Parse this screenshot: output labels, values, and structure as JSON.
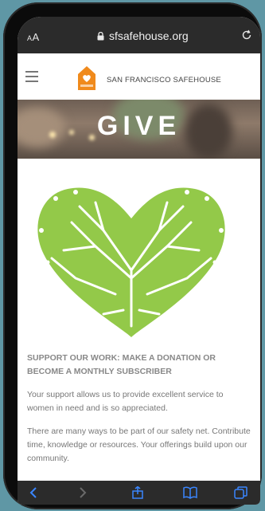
{
  "browser": {
    "aa_label_small": "A",
    "aa_label_large": "A",
    "url": "sfsafehouse.org"
  },
  "site": {
    "name": "SAN FRANCISCO SAFEHOUSE"
  },
  "hero": {
    "title": "GIVE"
  },
  "content": {
    "heading": "SUPPORT OUR WORK: MAKE A DONATION OR BECOME A MONTHLY SUBSCRIBER",
    "paragraph1": "Your support allows us to provide excellent service to women in need and is so appreciated.",
    "paragraph2": "There are many ways to be part of our safety net. Contribute time, knowledge or resources. Your offerings build upon our community."
  },
  "icons": {
    "back": "back-icon",
    "forward": "forward-icon",
    "share": "share-icon",
    "bookmarks": "bookmarks-icon",
    "tabs": "tabs-icon"
  },
  "colors": {
    "accent": "#f08a1c",
    "heart": "#8dc63f",
    "toolbar_icons": "#3a86ff"
  }
}
